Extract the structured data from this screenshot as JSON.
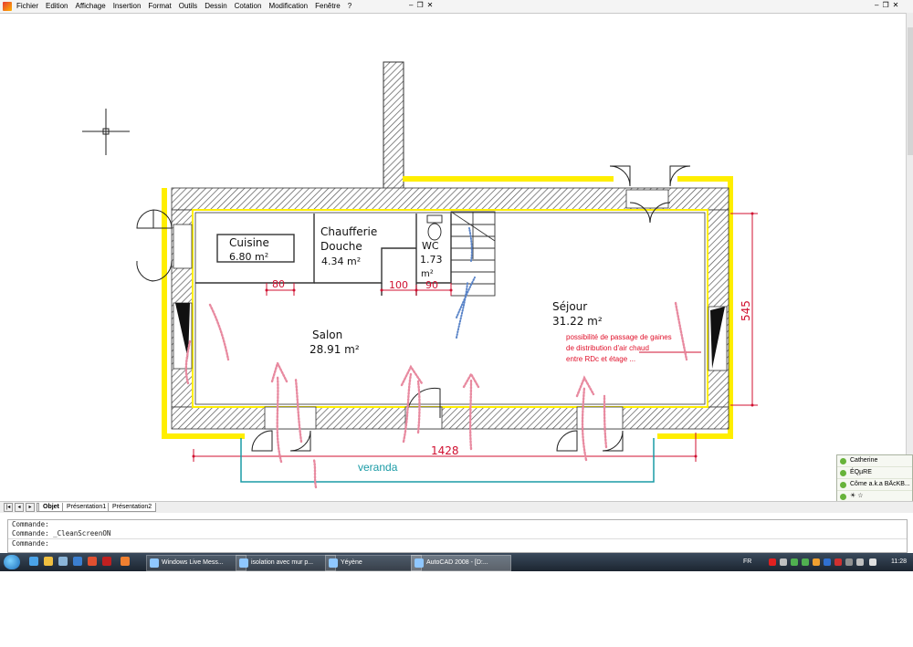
{
  "menu": {
    "items": [
      "Fichier",
      "Edition",
      "Affichage",
      "Insertion",
      "Format",
      "Outils",
      "Dessin",
      "Cotation",
      "Modification",
      "Fenêtre",
      "?"
    ]
  },
  "plan": {
    "rooms": [
      {
        "name": "Cuisine",
        "area": "6.80 m²"
      },
      {
        "name_line1": "Chaufferie",
        "name_line2": "Douche",
        "area": "4.34 m²"
      },
      {
        "name": "WC",
        "area_line1": "1.73",
        "area_line2": "m²"
      },
      {
        "name": "Séjour",
        "area": "31.22 m²"
      },
      {
        "name": "Salon",
        "area": "28.91 m²"
      }
    ],
    "dims": {
      "d80": "80",
      "d100": "100",
      "d90": "90",
      "d545": "545",
      "d1428": "1428"
    },
    "veranda_label": "veranda",
    "annotation": [
      "possibilité de passage de gaines",
      "de distribution d'air chaud",
      "entre RDc et étage ..."
    ]
  },
  "tabs": {
    "objet": "Objet",
    "p1": "Présentation1",
    "p2": "Présentation2"
  },
  "command": {
    "line1": "Commande:",
    "line2": "Commande: _CleanScreenON",
    "prompt": "Commande:"
  },
  "taskbar": {
    "tasks": [
      "Windows Live Mess...",
      "isolation avec mur p...",
      "Yéyène",
      "AutoCAD 2008 - [D:..."
    ],
    "lang": "FR",
    "clock": "11:28"
  },
  "messenger": {
    "contacts": [
      "Catherine",
      "ÉQµRE",
      "Côme a.k.a BÄcKB...",
      "☀ ☆"
    ]
  },
  "colors": {
    "wall_hatch": "#555555",
    "yellow": "#ffee00",
    "dim_red": "#d01030",
    "veranda": "#1a9ba6",
    "annot": "#e0102a"
  }
}
